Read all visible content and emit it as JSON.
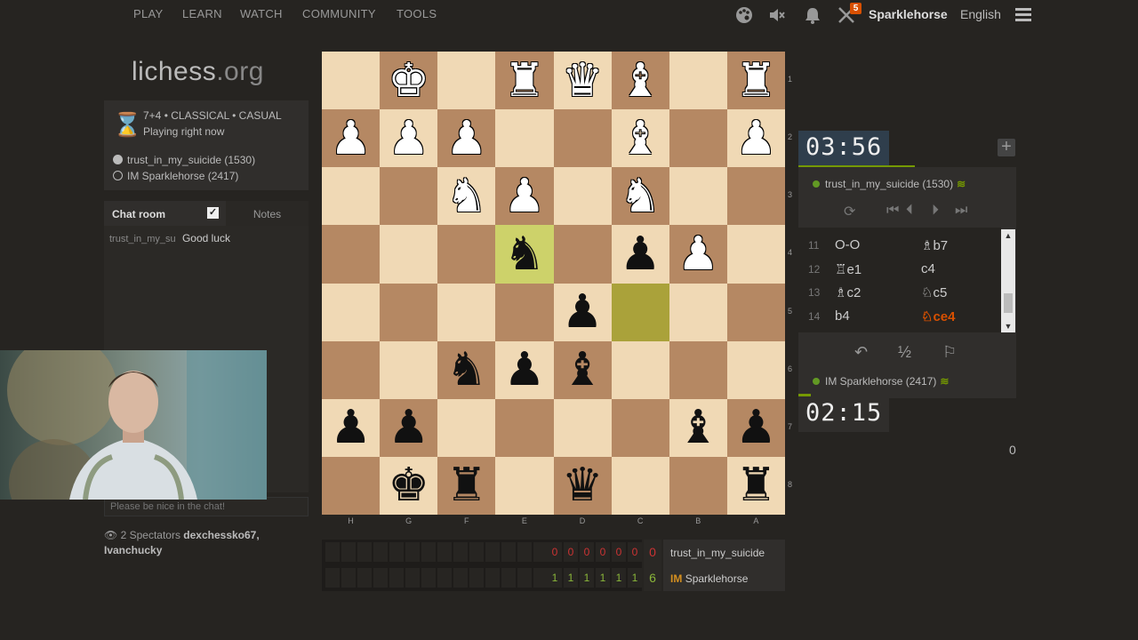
{
  "nav": {
    "items": [
      "PLAY",
      "LEARN",
      "WATCH",
      "COMMUNITY",
      "TOOLS"
    ],
    "username": "Sparklehorse",
    "language": "English",
    "challenge_badge": "5",
    "icons": [
      "palette-icon",
      "mute-icon",
      "bell-icon",
      "swords-icon",
      "hamburger-icon"
    ]
  },
  "logo": {
    "main": "lichess",
    "suffix": ".org"
  },
  "game": {
    "title": "7+4 • CLASSICAL • CASUAL",
    "subtitle": "Playing right now",
    "white_player": "trust_in_my_suicide (1530)",
    "black_player": "IM Sparklehorse (2417)"
  },
  "chat": {
    "tab_chat": "Chat room",
    "tab_notes": "Notes",
    "messages": [
      {
        "user": "trust_in_my_su",
        "text": "Good luck"
      }
    ],
    "placeholder": "Please be nice in the chat!"
  },
  "spectators": {
    "count_text": "2 Spectators",
    "names": "dexchessko67,",
    "names2": "Ivanchucky"
  },
  "board": {
    "ranks": [
      "1",
      "2",
      "3",
      "4",
      "5",
      "6",
      "7",
      "8"
    ],
    "files": [
      "H",
      "G",
      "F",
      "E",
      "D",
      "C",
      "B",
      "A"
    ],
    "pieces": [
      [
        "",
        "wK",
        "",
        "wR",
        "wQ",
        "wB",
        "",
        "wR"
      ],
      [
        "wP",
        "wP",
        "wP",
        "",
        "",
        "wB",
        "",
        "wP"
      ],
      [
        "",
        "",
        "wN",
        "wP",
        "",
        "wN",
        "",
        ""
      ],
      [
        "",
        "",
        "",
        "bN",
        "",
        "bP",
        "wP",
        ""
      ],
      [
        "",
        "",
        "",
        "",
        "bP",
        "",
        "",
        ""
      ],
      [
        "",
        "",
        "bN",
        "bP",
        "bB",
        "",
        "",
        ""
      ],
      [
        "bP",
        "bP",
        "",
        "",
        "",
        "",
        "bB",
        "bP"
      ],
      [
        "",
        "bK",
        "bR",
        "",
        "bQ",
        "",
        "",
        "bR"
      ]
    ],
    "last_move_from": [
      4,
      5
    ],
    "last_move_to": [
      3,
      3
    ]
  },
  "scores": {
    "top": {
      "cells": [
        "0",
        "0",
        "0",
        "0",
        "0",
        "0"
      ],
      "total": "0",
      "name": "trust_in_my_suicide",
      "title": ""
    },
    "bottom": {
      "cells": [
        "1",
        "1",
        "1",
        "1",
        "1",
        "1"
      ],
      "total": "6",
      "name": "Sparklehorse",
      "title": "IM"
    }
  },
  "clocks": {
    "opponent": {
      "min": "03",
      "sec": "56"
    },
    "me": {
      "min": "02",
      "sec": "15"
    }
  },
  "panel": {
    "top_player": "trust_in_my_suicide (1530)",
    "bottom_player": "IM Sparklehorse (2417)",
    "moves": [
      {
        "num": "11",
        "white": "O-O",
        "black": "♗b7"
      },
      {
        "num": "12",
        "white": "♖e1",
        "black": "c4"
      },
      {
        "num": "13",
        "white": "♗c2",
        "black": "♘c5"
      },
      {
        "num": "14",
        "white": "b4",
        "black": "♘ce4"
      }
    ],
    "controls": [
      "flip-icon",
      "first-icon",
      "prev-icon",
      "next-icon",
      "last-icon"
    ],
    "actions": [
      "takeback-icon",
      "draw-icon",
      "resign-icon"
    ]
  },
  "side_count": "0",
  "colors": {
    "accent_green": "#759900",
    "current_move": "#d85000",
    "light_square": "#f0d9b5",
    "dark_square": "#b58863"
  }
}
